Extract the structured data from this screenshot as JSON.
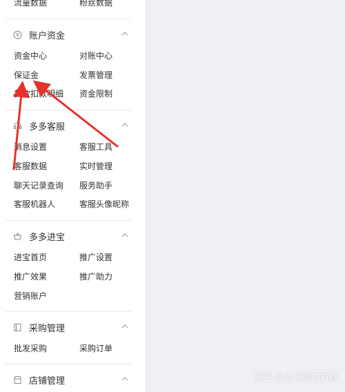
{
  "colors": {
    "background": "#ffffff",
    "content_background": "#eef0f4",
    "text": "#333333",
    "divider": "#e8e8e8",
    "annotation_arrow": "#e8302a"
  },
  "sections": [
    {
      "title": "",
      "items": [
        "流量数据",
        "粉丝数据"
      ]
    },
    {
      "title": "账户资金",
      "icon": "yen-circle-icon",
      "items": [
        "资金中心",
        "对账中心",
        "保证金",
        "发票管理",
        "货款扣款明细",
        "资金限制"
      ]
    },
    {
      "title": "多多客服",
      "icon": "headset-icon",
      "items": [
        "消息设置",
        "客服工具",
        "客服数据",
        "实时管理",
        "聊天记录查询",
        "服务助手",
        "客服机器人",
        "客服头像昵称"
      ]
    },
    {
      "title": "多多进宝",
      "icon": "treasure-bowl-icon",
      "items": [
        "进宝首页",
        "推广设置",
        "推广效果",
        "推广助力",
        "营销账户"
      ]
    },
    {
      "title": "采购管理",
      "icon": "clipboard-icon",
      "items": [
        "批发采购",
        "采购订单"
      ]
    },
    {
      "title": "店铺管理",
      "icon": "store-icon",
      "items": []
    }
  ],
  "watermark": "知乎 @做电商的白杨"
}
